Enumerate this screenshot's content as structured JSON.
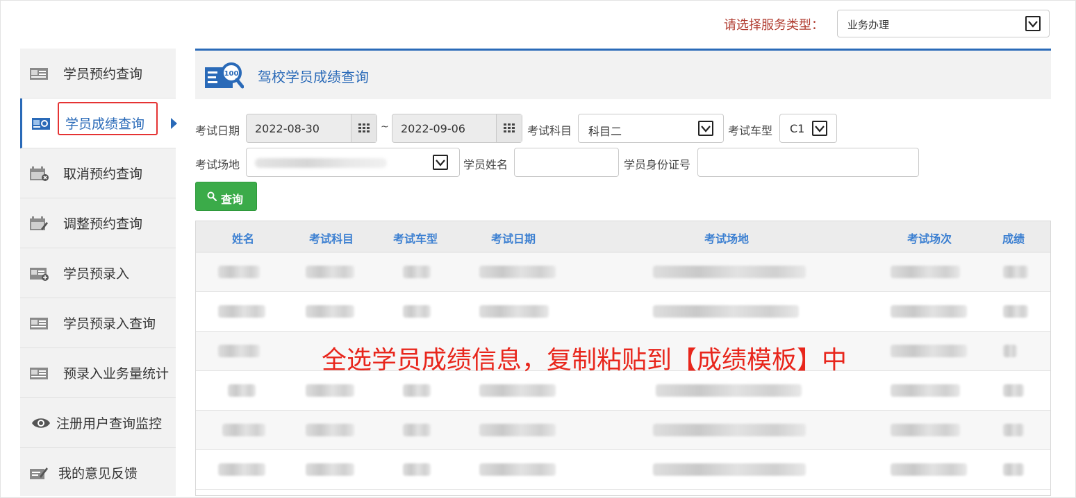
{
  "service": {
    "label": "请选择服务类型：",
    "selected": "业务办理"
  },
  "sidebar": {
    "items": [
      {
        "label": "学员预约查询",
        "icon": "id-card-icon"
      },
      {
        "label": "学员成绩查询",
        "icon": "score-card-icon",
        "active": true
      },
      {
        "label": "取消预约查询",
        "icon": "calendar-cancel-icon"
      },
      {
        "label": "调整预约查询",
        "icon": "calendar-edit-icon"
      },
      {
        "label": "学员预录入",
        "icon": "id-card-add-icon"
      },
      {
        "label": "学员预录入查询",
        "icon": "id-card-icon"
      },
      {
        "label": "预录入业务量统计",
        "icon": "id-card-icon"
      },
      {
        "label": "注册用户查询监控",
        "icon": "eye-icon"
      },
      {
        "label": "我的意见反馈",
        "icon": "feedback-icon"
      }
    ]
  },
  "panel": {
    "title": "驾校学员成绩查询"
  },
  "filters": {
    "exam_date_label": "考试日期",
    "date_from": "2022-08-30",
    "date_sep": "~",
    "date_to": "2022-09-06",
    "subject_label": "考试科目",
    "subject_value": "科目二",
    "vehicle_label": "考试车型",
    "vehicle_value": "C1",
    "venue_label": "考试场地",
    "name_label": "学员姓名",
    "id_label": "学员身份证号",
    "query_label": "查询"
  },
  "table": {
    "headers": [
      "姓名",
      "考试科目",
      "考试车型",
      "考试日期",
      "考试场地",
      "考试场次",
      "成绩"
    ]
  },
  "annotation": "全选学员成绩信息，复制粘贴到【成绩模板】中",
  "colors": {
    "accent": "#2a6ab8",
    "header_text": "#3b7fd1",
    "query_button": "#3bab49",
    "annotation": "#e8261c",
    "highlight_box": "#e53333",
    "service_label": "#b03a2e"
  }
}
